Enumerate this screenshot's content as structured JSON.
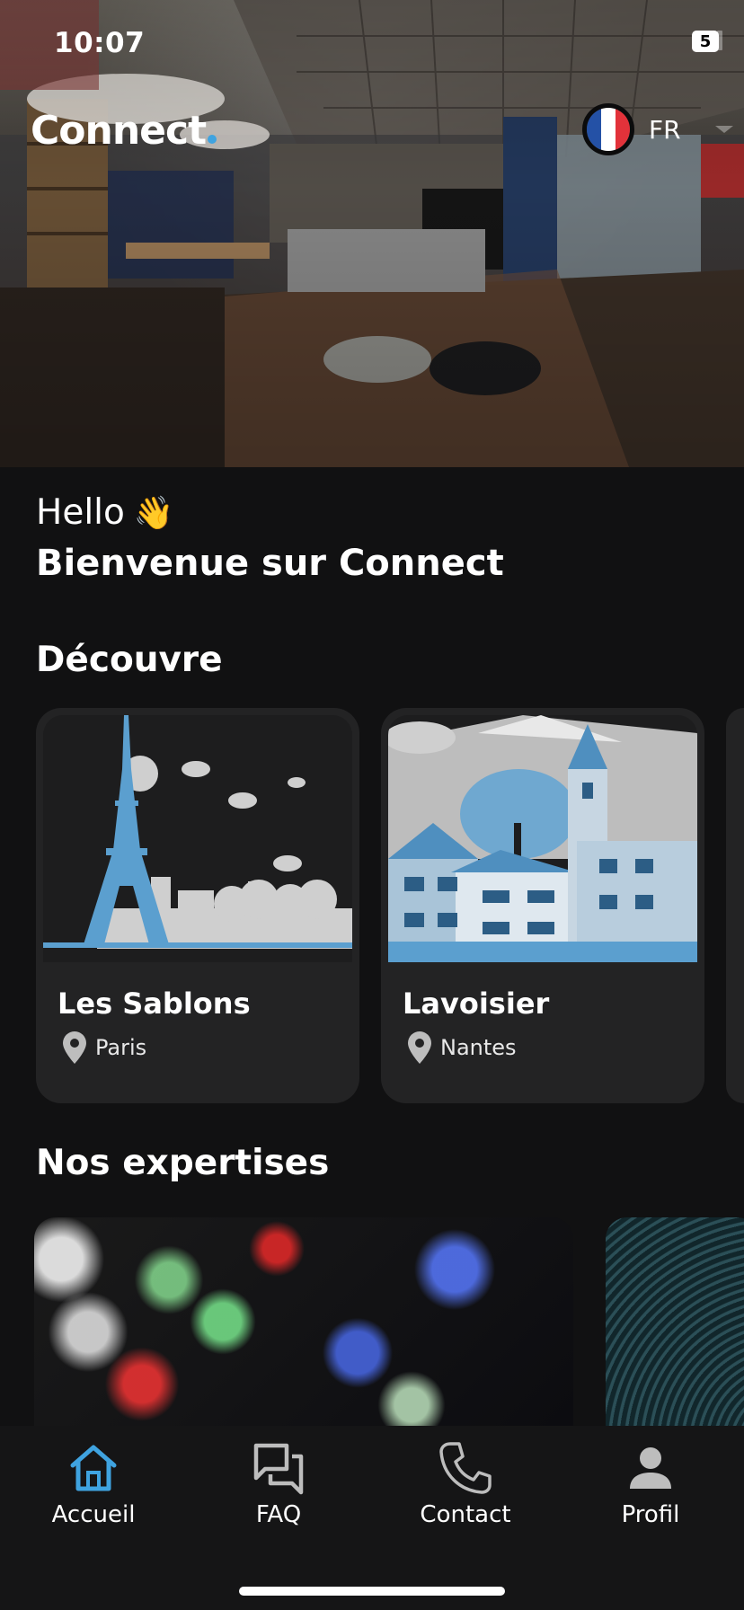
{
  "status_bar": {
    "time": "10:07",
    "battery": "5"
  },
  "header": {
    "brand": "Connect",
    "language": "FR"
  },
  "greeting": {
    "hello": "Hello",
    "emoji": "👋",
    "welcome": "Bienvenue sur Connect"
  },
  "discover": {
    "title": "Découvre",
    "sites": [
      {
        "name": "Les Sablons",
        "city": "Paris"
      },
      {
        "name": "Lavoisier",
        "city": "Nantes"
      }
    ]
  },
  "expertises": {
    "title": "Nos expertises"
  },
  "tabs": [
    {
      "label": "Accueil",
      "icon": "home-icon",
      "active": true
    },
    {
      "label": "FAQ",
      "icon": "chat-bubbles-icon",
      "active": false
    },
    {
      "label": "Contact",
      "icon": "phone-icon",
      "active": false
    },
    {
      "label": "Profil",
      "icon": "person-icon",
      "active": false
    }
  ],
  "colors": {
    "accent": "#3fa3e0",
    "background": "#111112",
    "card": "#232324",
    "illustration_blue": "#5b9fcf",
    "illustration_grey": "#cfcfcf"
  }
}
